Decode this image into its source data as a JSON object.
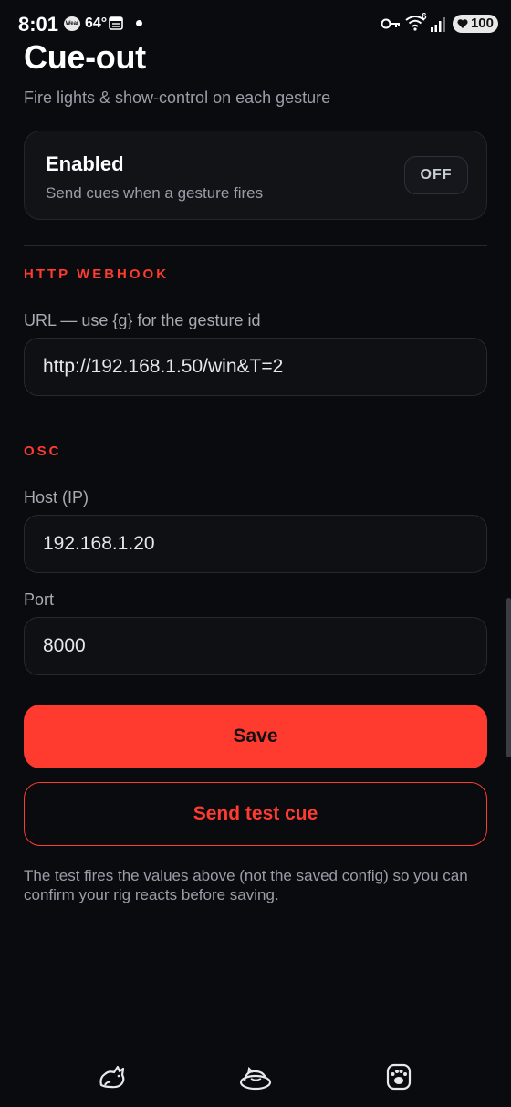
{
  "status_bar": {
    "time": "8:01",
    "weather_label": "Wear",
    "temperature": "64°",
    "wifi_generation": "6",
    "battery": "100"
  },
  "header": {
    "title": "Cue-out",
    "subtitle": "Fire lights & show-control on each gesture"
  },
  "enabled_card": {
    "title": "Enabled",
    "description": "Send cues when a gesture fires",
    "toggle_label": "OFF"
  },
  "http_webhook": {
    "heading": "HTTP WEBHOOK",
    "url_label": "URL — use {g} for the gesture id",
    "url_value": "http://192.168.1.50/win&T=2"
  },
  "osc": {
    "heading": "OSC",
    "host_label": "Host (IP)",
    "host_value": "192.168.1.20",
    "port_label": "Port",
    "port_value": "8000"
  },
  "actions": {
    "save_label": "Save",
    "test_label": "Send test cue",
    "footnote": "The test fires the values above (not the saved config) so you can confirm your rig reacts before saving."
  },
  "bottom_nav": {
    "items": [
      {
        "icon": "cat-stretch-icon"
      },
      {
        "icon": "cat-bed-icon"
      },
      {
        "icon": "paw-icon"
      }
    ]
  },
  "colors": {
    "accent": "#ff3b30",
    "background": "#0a0b0e",
    "card": "#111317",
    "muted_text": "#9a9ea8"
  }
}
